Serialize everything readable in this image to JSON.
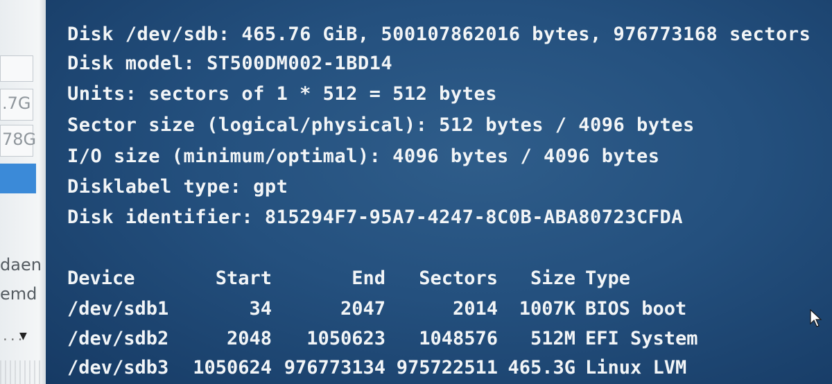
{
  "left_panel": {
    "size_label_1": ".7G",
    "size_label_2": "78G",
    "text_1": "daen",
    "text_2": "emd",
    "dots": "...",
    "dropdown_arrow": "▼"
  },
  "terminal": {
    "lines": [
      "Disk /dev/sdb: 465.76 GiB, 500107862016 bytes, 976773168 sectors",
      "Disk model: ST500DM002-1BD14",
      "Units: sectors of 1 * 512 = 512 bytes",
      "Sector size (logical/physical): 512 bytes / 4096 bytes",
      "I/O size (minimum/optimal): 4096 bytes / 4096 bytes",
      "Disklabel type: gpt",
      "Disk identifier: 815294F7-95A7-4247-8C0B-ABA80723CFDA"
    ],
    "table": {
      "headers": [
        "Device",
        "Start",
        "End",
        "Sectors",
        "Size",
        "Type"
      ],
      "rows": [
        [
          "/dev/sdb1",
          "34",
          "2047",
          "2014",
          "1007K",
          "BIOS boot"
        ],
        [
          "/dev/sdb2",
          "2048",
          "1050623",
          "1048576",
          "512M",
          "EFI System"
        ],
        [
          "/dev/sdb3",
          "1050624",
          "976773134",
          "975722511",
          "465.3G",
          "Linux LVM"
        ]
      ]
    }
  },
  "colors": {
    "terminal_bg": "#24507e",
    "terminal_text": "#f2f5f7",
    "selection": "#3b8ad8"
  },
  "icons": {
    "cursor": "mouse-pointer-icon"
  }
}
